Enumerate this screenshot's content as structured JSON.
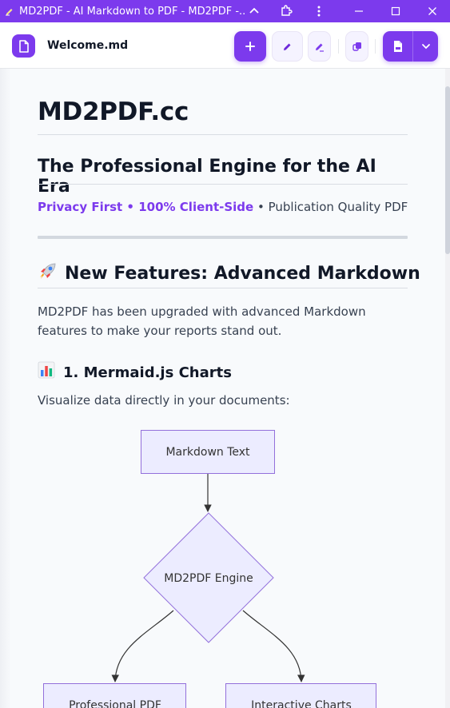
{
  "window": {
    "title": "MD2PDF - AI Markdown to PDF - MD2PDF -..."
  },
  "toolbar": {
    "filename": "Welcome.md"
  },
  "document": {
    "h1": "MD2PDF.cc",
    "h2_engine": "The Professional Engine for the AI Era",
    "tagline_accent": "Privacy First • 100% Client-Side",
    "tagline_rest": " • Publication Quality PDF",
    "h2_features": "New Features: Advanced Markdown",
    "intro": "MD2PDF has been upgraded with advanced Markdown features to make your reports stand out.",
    "h3_mermaid": "1. Mermaid.js Charts",
    "visualize": "Visualize data directly in your documents:"
  },
  "diagram": {
    "node_source": "Markdown Text",
    "node_engine": "MD2PDF Engine",
    "node_pdf": "Professional PDF",
    "node_charts": "Interactive Charts"
  },
  "colors": {
    "accent": "#7c3aed",
    "node_fill": "#ececff",
    "node_stroke": "#9370db"
  }
}
